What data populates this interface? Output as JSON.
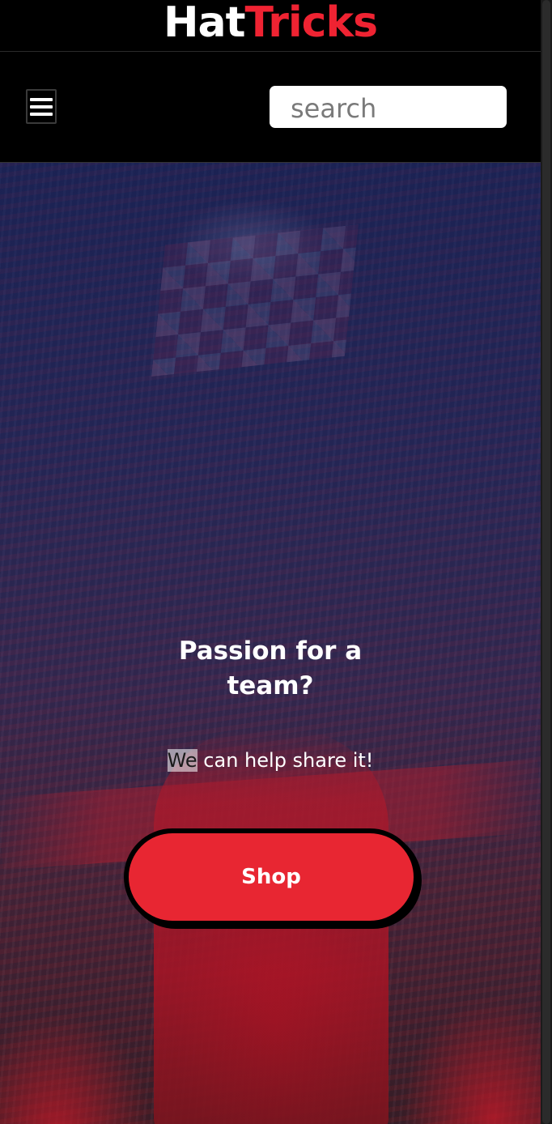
{
  "brand": {
    "first": "Hat",
    "second": "Tricks",
    "colors": {
      "first": "#ffffff",
      "second": "#ef2332"
    }
  },
  "nav": {
    "menu_icon": "hamburger-menu-icon",
    "search_placeholder": "search"
  },
  "hero": {
    "title_line1": "Passion for a",
    "title_line2": "team?",
    "subtitle_highlight": "We",
    "subtitle_rest": " can help share it!",
    "cta_label": "Shop",
    "cta_color": "#e82632"
  }
}
